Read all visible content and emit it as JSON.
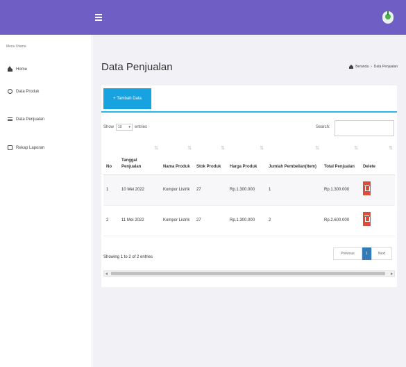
{
  "sidebar": {
    "section_label": "Menu Utama",
    "items": [
      {
        "label": "Home",
        "icon": "home-icon"
      },
      {
        "label": "Data Produk",
        "icon": "circle-icon"
      },
      {
        "label": "Data Penjualan",
        "icon": "list-icon"
      },
      {
        "label": "Rekap Laporan",
        "icon": "document-icon"
      }
    ]
  },
  "header": {
    "menu_icon": "hamburger-icon",
    "accent": "#6f5fc4"
  },
  "page": {
    "title": "Data Penjualan",
    "breadcrumb": [
      "Beranda",
      "Data Penjualan"
    ]
  },
  "card": {
    "add_button": "+ Tambah Data",
    "show_prefix": "Show",
    "show_value": "10",
    "show_suffix": "entries",
    "search_label": "Search:",
    "search_value": ""
  },
  "table": {
    "headers": [
      "No",
      "Tanggal Penjualan",
      "Nama Produk",
      "Stok Produk",
      "Harga Produk",
      "Jumlah Pembelian(Item)",
      "Total Penjualan",
      "Delete"
    ],
    "rows": [
      [
        "1",
        "10 Mei 2022",
        "Kompor Listrik",
        "27",
        "Rp.1.300.000",
        "1",
        "Rp.1.300.000"
      ],
      [
        "2",
        "11 Mei 2022",
        "Kompor Listrik",
        "27",
        "Rp.1.300.000",
        "2",
        "Rp.2.600.000"
      ]
    ],
    "delete_color": "#dd4b39"
  },
  "footer": {
    "showing": "Showing 1 to 2 of 2 entries",
    "prev": "Previous",
    "page": "1",
    "next": "Next"
  }
}
